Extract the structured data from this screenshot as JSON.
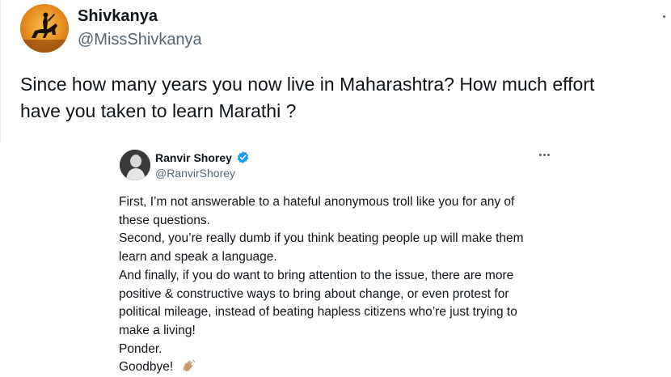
{
  "tweet": {
    "author_name": "Shivkanya",
    "author_handle": "@MissShivkanya",
    "text": "Since how many years you now live in Maharashtra? How much effort\nhave you taken to learn Marathi ?"
  },
  "reply": {
    "author_name": "Ranvir Shorey",
    "author_handle": "@RanvirShorey",
    "lines": [
      "First, I’m not answerable to a hateful anonymous troll like you for any of",
      "these questions.",
      "Second, you’re really dumb if you think beating people up will make them",
      "learn and speak a language.",
      "And finally, if you do want to bring attention to the issue, there are more",
      "positive & constructive ways to bring about change, or even protest for",
      "political mileage, instead of beating hapless citizens who’re just trying to",
      "make a living!",
      "Ponder.",
      "Goodbye!"
    ]
  },
  "colors": {
    "text": "#0f1419",
    "secondary": "#536471",
    "verified": "#1d9bf0"
  },
  "icons": [
    "more-options-icon",
    "verified-badge-icon",
    "waving-hand-icon"
  ]
}
